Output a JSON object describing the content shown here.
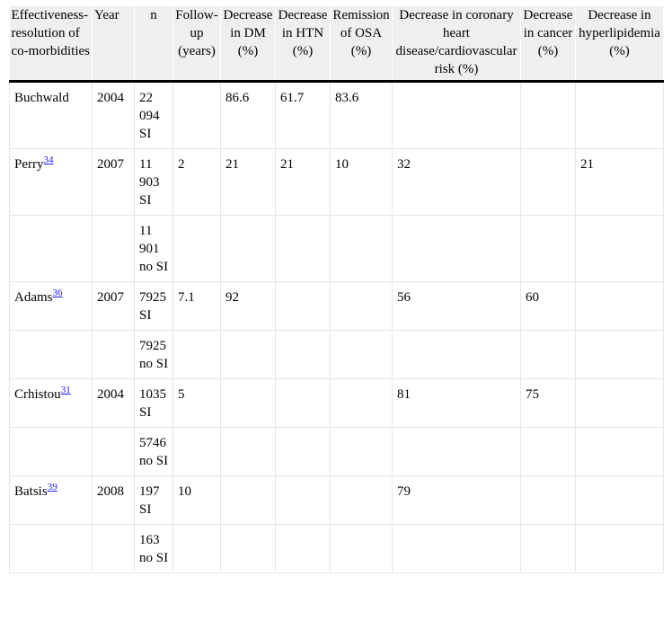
{
  "headers": [
    "Effectiveness-resolution of co-morbidities",
    "Year",
    "n",
    "Follow-up (years)",
    "Decrease in DM (%)",
    "Decrease in HTN (%)",
    "Remission of OSA (%)",
    "Decrease in coronary heart disease/cardiovascular risk (%)",
    "Decrease in cancer (%)",
    "Decrease in hyperlipidemia (%)"
  ],
  "rows": [
    {
      "author": "Buchwald",
      "ref": "",
      "year": "2004",
      "n": "22 094 SI",
      "followup": "",
      "dm": "86.6",
      "htn": "61.7",
      "osa": "83.6",
      "chd": "",
      "cancer": "",
      "hyper": ""
    },
    {
      "author": "Perry",
      "ref": "34",
      "year": "2007",
      "n": "11 903 SI",
      "followup": "2",
      "dm": "21",
      "htn": "21",
      "osa": "10",
      "chd": "32",
      "cancer": "",
      "hyper": "21"
    },
    {
      "author": "",
      "ref": "",
      "year": "",
      "n": "11 901 no SI",
      "followup": "",
      "dm": "",
      "htn": "",
      "osa": "",
      "chd": "",
      "cancer": "",
      "hyper": ""
    },
    {
      "author": "Adams",
      "ref": "36",
      "year": "2007",
      "n": "7925 SI",
      "followup": "7.1",
      "dm": "92",
      "htn": "",
      "osa": "",
      "chd": "56",
      "cancer": "60",
      "hyper": ""
    },
    {
      "author": "",
      "ref": "",
      "year": "",
      "n": "7925 no SI",
      "followup": "",
      "dm": "",
      "htn": "",
      "osa": "",
      "chd": "",
      "cancer": "",
      "hyper": ""
    },
    {
      "author": "Crhistou",
      "ref": "31",
      "year": "2004",
      "n": "1035 SI",
      "followup": "5",
      "dm": "",
      "htn": "",
      "osa": "",
      "chd": "81",
      "cancer": "75",
      "hyper": ""
    },
    {
      "author": "",
      "ref": "",
      "year": "",
      "n": "5746 no SI",
      "followup": "",
      "dm": "",
      "htn": "",
      "osa": "",
      "chd": "",
      "cancer": "",
      "hyper": ""
    },
    {
      "author": "Batsis",
      "ref": "39",
      "year": "2008",
      "n": "197 SI",
      "followup": "10",
      "dm": "",
      "htn": "",
      "osa": "",
      "chd": "79",
      "cancer": "",
      "hyper": ""
    },
    {
      "author": "",
      "ref": "",
      "year": "",
      "n": "163 no SI",
      "followup": "",
      "dm": "",
      "htn": "",
      "osa": "",
      "chd": "",
      "cancer": "",
      "hyper": ""
    }
  ]
}
